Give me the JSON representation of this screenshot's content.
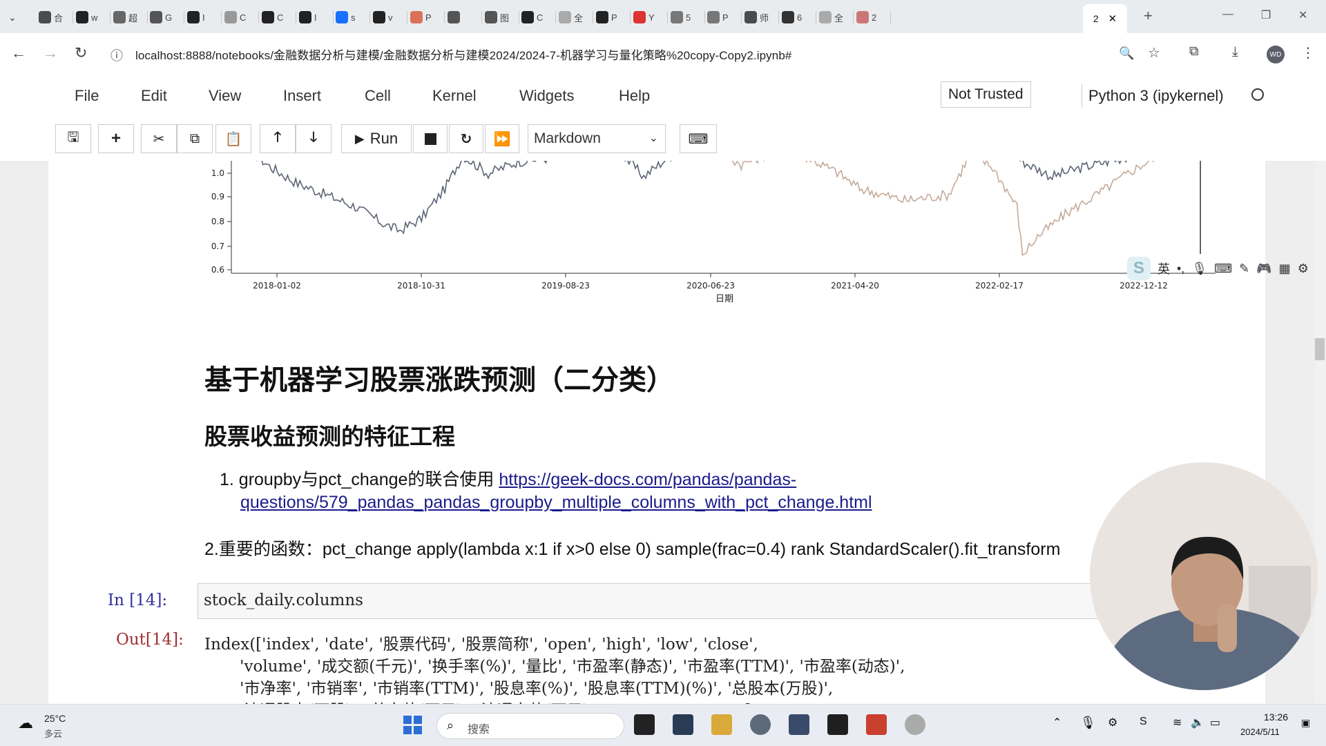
{
  "browser": {
    "tabs": [
      {
        "label": "合",
        "icon": "bilibili-icon"
      },
      {
        "label": "w",
        "icon": "github-icon"
      },
      {
        "label": "超",
        "icon": "star-icon"
      },
      {
        "label": "G",
        "icon": "translate-icon"
      },
      {
        "label": "I",
        "icon": "github-icon"
      },
      {
        "label": "C",
        "icon": "cube-icon"
      },
      {
        "label": "C",
        "icon": "mail-icon"
      },
      {
        "label": "I",
        "icon": "github-icon"
      },
      {
        "label": "s",
        "icon": "zhihu-icon"
      },
      {
        "label": "v",
        "icon": "github-icon"
      },
      {
        "label": "P",
        "icon": "c-icon"
      },
      {
        "label": "",
        "icon": "cloud-icon"
      },
      {
        "label": "图",
        "icon": "cloud-icon"
      },
      {
        "label": "C",
        "icon": "github-icon"
      },
      {
        "label": "全",
        "icon": "loading-icon"
      },
      {
        "label": "P",
        "icon": "cap-icon"
      },
      {
        "label": "Y",
        "icon": "youtube-icon"
      },
      {
        "label": "5",
        "icon": "bracket-icon"
      },
      {
        "label": "P",
        "icon": "g-icon"
      },
      {
        "label": "师",
        "icon": "bilibili-icon"
      },
      {
        "label": "6",
        "icon": "chart-icon"
      },
      {
        "label": "全",
        "icon": "loading-icon"
      },
      {
        "label": "2",
        "icon": "note-icon"
      }
    ],
    "active_tab_label": "2",
    "url": "localhost:8888/notebooks/金融数据分析与建模/金融数据分析与建模2024/2024-7-机器学习与量化策略%20copy-Copy2.ipynb#",
    "profile_initials": "WD"
  },
  "jupyter": {
    "menu": [
      "File",
      "Edit",
      "View",
      "Insert",
      "Cell",
      "Kernel",
      "Widgets",
      "Help"
    ],
    "trust_status": "Not Trusted",
    "kernel": "Python 3 (ipykernel)",
    "run_label": "Run",
    "cell_type": "Markdown"
  },
  "chart_data": {
    "type": "line",
    "title": "",
    "xlabel": "日期",
    "ylabel": "",
    "ylim": [
      0.6,
      1.0
    ],
    "yticks": [
      "1.0",
      "0.9",
      "0.8",
      "0.7",
      "0.6"
    ],
    "xticks": [
      "2018-01-02",
      "2018-10-31",
      "2019-08-23",
      "2020-06-23",
      "2021-04-20",
      "2022-02-17",
      "2022-12-12"
    ],
    "series": [
      {
        "color": "#5b6475",
        "points": [
          [
            "2018-01-02",
            1.0
          ],
          [
            "2018-02-10",
            0.95
          ],
          [
            "2018-04-01",
            0.9
          ],
          [
            "2018-06-01",
            0.86
          ],
          [
            "2018-08-01",
            0.82
          ],
          [
            "2018-10-01",
            0.76
          ],
          [
            "2018-10-31",
            0.74
          ],
          [
            "2018-12-15",
            0.78
          ],
          [
            "2019-02-01",
            0.88
          ],
          [
            "2019-03-10",
            0.99
          ],
          [
            "2019-05-01",
            0.93
          ],
          [
            "2019-07-01",
            0.97
          ],
          [
            "2019-08-23",
            0.98
          ],
          [
            "2019-10-15",
            0.99
          ],
          [
            "2019-12-01",
            1.0
          ],
          [
            "2020-01-15",
            1.02
          ],
          [
            "2020-03-15",
            0.92
          ],
          [
            "2020-05-01",
            0.98
          ],
          [
            "2020-06-23",
            1.03
          ],
          [
            "2022-03-01",
            1.04
          ],
          [
            "2022-05-01",
            0.97
          ],
          [
            "2022-07-01",
            0.92
          ],
          [
            "2022-09-01",
            0.95
          ],
          [
            "2022-12-12",
            0.99
          ],
          [
            "2023-02-15",
            1.01
          ]
        ]
      },
      {
        "color": "#c4aa9a",
        "points": [
          [
            "2018-01-02",
            1.0
          ],
          [
            "2020-06-23",
            1.0
          ],
          [
            "2020-08-01",
            1.02
          ],
          [
            "2020-10-01",
            0.96
          ],
          [
            "2021-01-01",
            1.02
          ],
          [
            "2021-04-20",
            0.93
          ],
          [
            "2021-06-01",
            0.88
          ],
          [
            "2021-09-01",
            0.84
          ],
          [
            "2021-12-01",
            0.86
          ],
          [
            "2022-01-15",
            1.0
          ],
          [
            "2022-03-01",
            0.95
          ],
          [
            "2022-04-20",
            0.82
          ],
          [
            "2022-05-01",
            0.66
          ],
          [
            "2022-06-01",
            0.72
          ],
          [
            "2022-08-01",
            0.8
          ],
          [
            "2022-10-01",
            0.86
          ],
          [
            "2022-12-12",
            0.94
          ],
          [
            "2023-02-15",
            1.0
          ]
        ]
      }
    ],
    "cursor_line": "2023-05-01"
  },
  "notebook": {
    "heading1": "基于机器学习股票涨跌预测（二分类）",
    "heading2": "股票收益预测的特征工程",
    "item1_prefix": "1. groupby与pct_change的联合使用",
    "item1_link_line1": "https://geek-docs.com/pandas/pandas-",
    "item1_link_line2": "questions/579_pandas_pandas_groupby_multiple_columns_with_pct_change.html",
    "item2": "2.重要的函数：pct_change apply(lambda x:1 if x>0 else 0) sample(frac=0.4) rank StandardScaler().fit_transform",
    "in_prompt": "In  [14]:",
    "code": "stock_daily.columns",
    "out_prompt": "Out[14]:",
    "output_lines": [
      "Index(['index', 'date', '股票代码', '股票简称', 'open', 'high', 'low', 'close',",
      "       'volume', '成交额(千元)', '换手率(%)', '量比', '市盈率(静态)', '市盈率(TTM)', '市盈率(动态)',",
      "       '市净率', '市销率', '市销率(TTM)', '股息率(%)', '股息率(TTM)(%)', '总股本(万股)',",
      "       '流通股本(万股)', '总市值(万元)', '流通市值(万元)', 'circ_mv_percent'],"
    ]
  },
  "ime": {
    "lang": "英"
  },
  "taskbar": {
    "weather_temp": "25°C",
    "weather_desc": "多云",
    "search_placeholder": "搜索",
    "time": "13:26",
    "date": "2024/5/11"
  }
}
